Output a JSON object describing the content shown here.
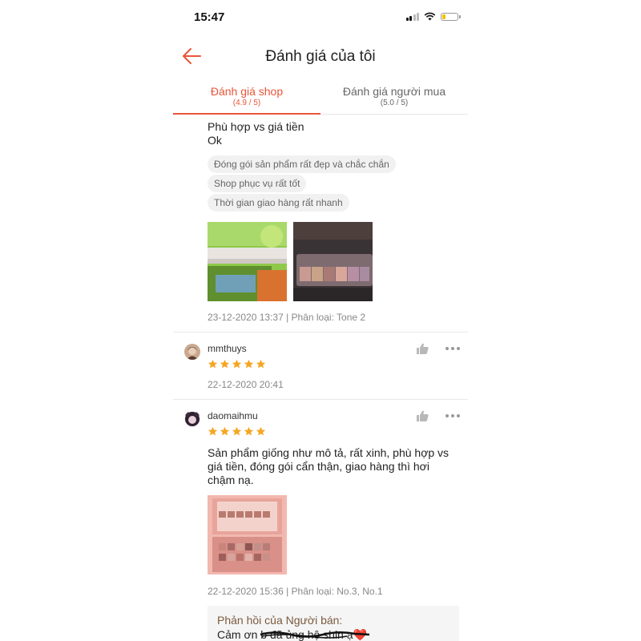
{
  "status_bar": {
    "time": "15:47"
  },
  "header": {
    "title": "Đánh giá của tôi",
    "back_icon": "arrow-left-icon"
  },
  "tabs": [
    {
      "label": "Đánh giá shop",
      "score": "(4.9 / 5)",
      "active": true
    },
    {
      "label": "Đánh giá người mua",
      "score": "(5.0 / 5)",
      "active": false
    }
  ],
  "reviews": [
    {
      "text_lines": [
        "Phù hợp vs giá tiền",
        "Ok"
      ],
      "tags": [
        "Đóng gói sản phẩm rất đẹp và chắc chắn",
        "Shop phục vụ rất tốt",
        "Thời gian giao hàng rất nhanh"
      ],
      "meta": "23-12-2020 13:37 | Phân loại: Tone 2",
      "photos": 2
    },
    {
      "username": "mmthuys",
      "stars": 5,
      "meta": "22-12-2020 20:41"
    },
    {
      "username": "daomaihmu",
      "stars": 5,
      "text": "Sản phẩm giống như mô tả, rất xinh, phù hợp vs giá tiền, đóng gói cẩn thận, giao hàng thì hơi chậm nạ.",
      "meta": "22-12-2020 15:36 | Phân loại: No.3, No.1",
      "seller_reply": {
        "title": "Phản hồi của Người bán:",
        "text": "Cảm ơn b đã ủng hộ shin ạ❤️"
      }
    }
  ],
  "colors": {
    "accent": "#e8553a",
    "star": "#f5a623",
    "reply_title": "#7b5a3e"
  }
}
